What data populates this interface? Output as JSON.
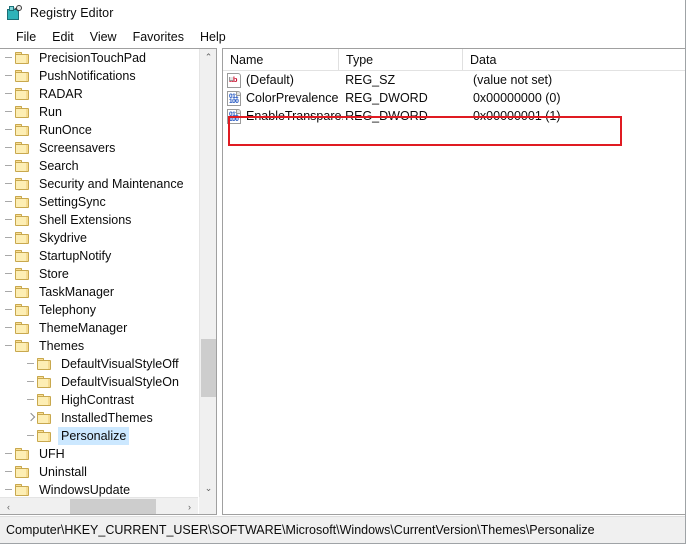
{
  "window": {
    "title": "Registry Editor",
    "icon": "registry-editor-icon"
  },
  "menubar": {
    "items": [
      {
        "label": "File"
      },
      {
        "label": "Edit"
      },
      {
        "label": "View"
      },
      {
        "label": "Favorites"
      },
      {
        "label": "Help"
      }
    ]
  },
  "tree": {
    "items": [
      {
        "label": "PrecisionTouchPad",
        "indent": 1,
        "expander": "none",
        "selected": false
      },
      {
        "label": "PushNotifications",
        "indent": 1,
        "expander": "none",
        "selected": false
      },
      {
        "label": "RADAR",
        "indent": 1,
        "expander": "none",
        "selected": false
      },
      {
        "label": "Run",
        "indent": 1,
        "expander": "none",
        "selected": false
      },
      {
        "label": "RunOnce",
        "indent": 1,
        "expander": "none",
        "selected": false
      },
      {
        "label": "Screensavers",
        "indent": 1,
        "expander": "none",
        "selected": false
      },
      {
        "label": "Search",
        "indent": 1,
        "expander": "none",
        "selected": false
      },
      {
        "label": "Security and Maintenance",
        "indent": 1,
        "expander": "none",
        "selected": false
      },
      {
        "label": "SettingSync",
        "indent": 1,
        "expander": "none",
        "selected": false
      },
      {
        "label": "Shell Extensions",
        "indent": 1,
        "expander": "none",
        "selected": false
      },
      {
        "label": "Skydrive",
        "indent": 1,
        "expander": "none",
        "selected": false
      },
      {
        "label": "StartupNotify",
        "indent": 1,
        "expander": "none",
        "selected": false
      },
      {
        "label": "Store",
        "indent": 1,
        "expander": "none",
        "selected": false
      },
      {
        "label": "TaskManager",
        "indent": 1,
        "expander": "none",
        "selected": false
      },
      {
        "label": "Telephony",
        "indent": 1,
        "expander": "none",
        "selected": false
      },
      {
        "label": "ThemeManager",
        "indent": 1,
        "expander": "none",
        "selected": false
      },
      {
        "label": "Themes",
        "indent": 1,
        "expander": "none",
        "selected": false
      },
      {
        "label": "DefaultVisualStyleOff",
        "indent": 2,
        "expander": "none",
        "selected": false
      },
      {
        "label": "DefaultVisualStyleOn",
        "indent": 2,
        "expander": "none",
        "selected": false
      },
      {
        "label": "HighContrast",
        "indent": 2,
        "expander": "none",
        "selected": false
      },
      {
        "label": "InstalledThemes",
        "indent": 2,
        "expander": "collapsed",
        "selected": false
      },
      {
        "label": "Personalize",
        "indent": 2,
        "expander": "none",
        "selected": true
      },
      {
        "label": "UFH",
        "indent": 1,
        "expander": "none",
        "selected": false
      },
      {
        "label": "Uninstall",
        "indent": 1,
        "expander": "none",
        "selected": false
      },
      {
        "label": "WindowsUpdate",
        "indent": 1,
        "expander": "none",
        "selected": false
      }
    ],
    "vertical_scrollbar": {
      "up_arrow": "⌃",
      "down_arrow": "⌄"
    },
    "horizontal_scrollbar": {
      "left_arrow": "‹",
      "right_arrow": "›"
    }
  },
  "list": {
    "columns": [
      {
        "label": "Name"
      },
      {
        "label": "Type"
      },
      {
        "label": "Data"
      }
    ],
    "rows": [
      {
        "icon": "reg-sz-icon",
        "icon_kind": "sz",
        "icon_text": "ab",
        "name": "(Default)",
        "type": "REG_SZ",
        "data": "(value not set)",
        "highlighted": false
      },
      {
        "icon": "reg-dword-icon",
        "icon_kind": "dw",
        "icon_line1": "011",
        "icon_line2": "100",
        "name": "ColorPrevalence",
        "type": "REG_DWORD",
        "data": "0x00000000 (0)",
        "highlighted": false
      },
      {
        "icon": "reg-dword-icon",
        "icon_kind": "dw",
        "icon_line1": "011",
        "icon_line2": "100",
        "name": "EnableTranspare...",
        "type": "REG_DWORD",
        "data": "0x00000001 (1)",
        "highlighted": true
      }
    ]
  },
  "annotation": {
    "color": "#e01b22",
    "target": "EnableTranspare..."
  },
  "statusbar": {
    "path": "Computer\\HKEY_CURRENT_USER\\SOFTWARE\\Microsoft\\Windows\\CurrentVersion\\Themes\\Personalize"
  }
}
